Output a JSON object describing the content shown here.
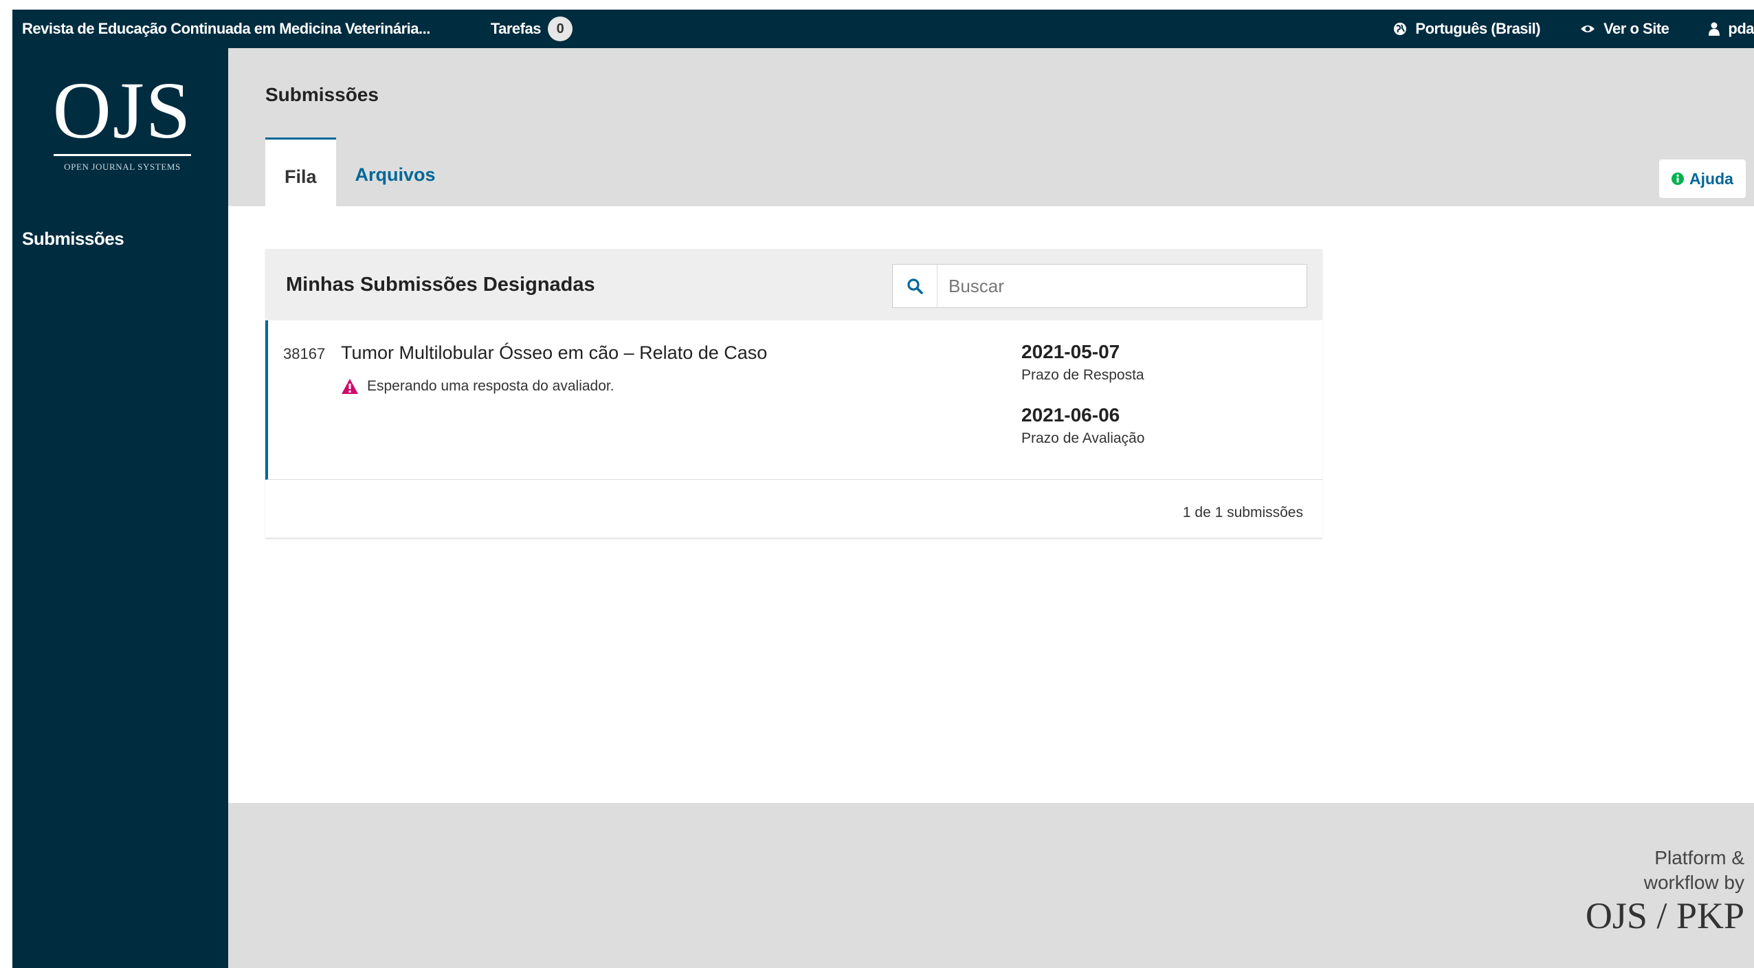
{
  "topbar": {
    "site_title": "Revista de Educação Continuada em Medicina Veterinária...",
    "tasks_label": "Tarefas",
    "tasks_count": "0",
    "language": "Português (Brasil)",
    "view_site": "Ver o Site",
    "user": "pda"
  },
  "logo": {
    "text": "OJS",
    "subtitle": "OPEN JOURNAL SYSTEMS"
  },
  "sidebar": {
    "items": [
      {
        "label": "Submissões"
      }
    ]
  },
  "header": {
    "title": "Submissões",
    "tabs": [
      {
        "label": "Fila",
        "active": true
      },
      {
        "label": "Arquivos",
        "active": false
      }
    ],
    "help_label": "Ajuda"
  },
  "panel": {
    "title": "Minhas Submissões Designadas",
    "search_placeholder": "Buscar",
    "submissions": [
      {
        "id": "38167",
        "title": "Tumor Multilobular Ósseo em cão – Relato de Caso",
        "notice": "Esperando uma resposta do avaliador.",
        "response_due": "2021-05-07",
        "response_due_label": "Prazo de Resposta",
        "review_due": "2021-06-06",
        "review_due_label": "Prazo de Avaliação"
      }
    ],
    "count_text": "1 de 1 submissões"
  },
  "footer": {
    "line1": "Platform &",
    "line2": "workflow by",
    "brand": "OJS / PKP"
  },
  "colors": {
    "navy": "#002c40",
    "link_blue": "#006798",
    "help_green": "#00b24e",
    "warning_pink": "#d00a6c",
    "gray_bg": "#dddddd"
  }
}
